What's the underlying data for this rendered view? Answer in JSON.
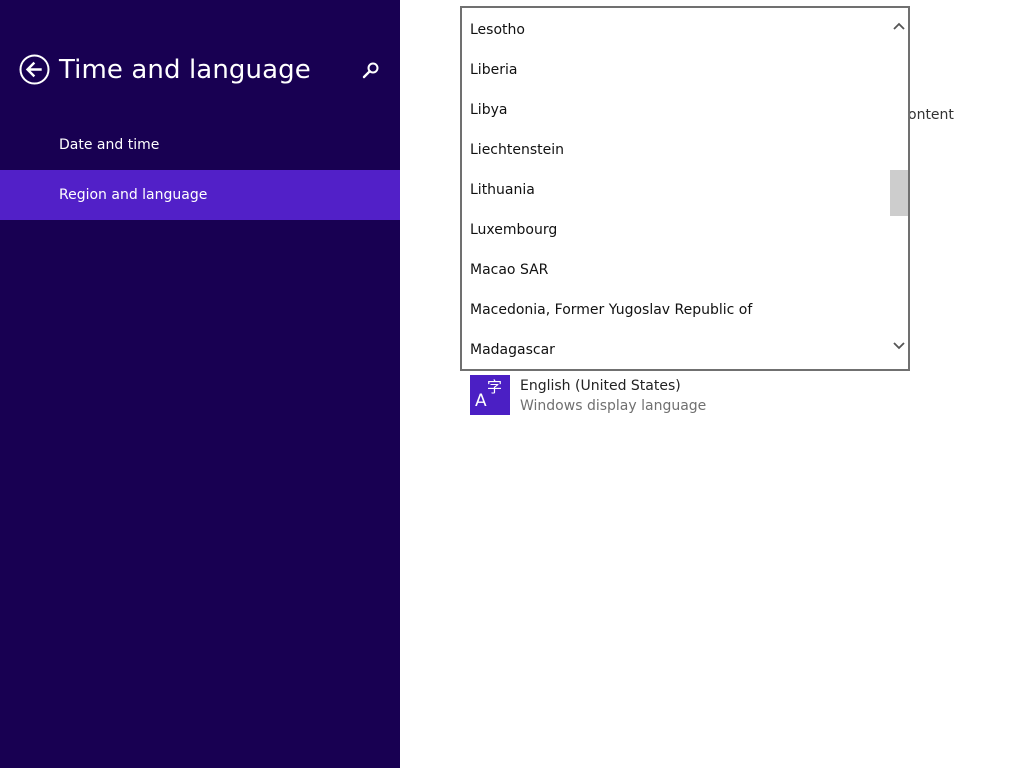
{
  "nav": {
    "title": "Time and language",
    "items": [
      {
        "label": "Date and time",
        "selected": false
      },
      {
        "label": "Region and language",
        "selected": true
      }
    ]
  },
  "content": {
    "partial_text": "ontent",
    "language": {
      "tile_glyph_a": "A",
      "tile_glyph_ji": "字",
      "name": "English (United States)",
      "subtitle": "Windows display language"
    }
  },
  "dropdown": {
    "items": [
      "Lesotho",
      "Liberia",
      "Libya",
      "Liechtenstein",
      "Lithuania",
      "Luxembourg",
      "Macao SAR",
      "Macedonia, Former Yugoslav Republic of",
      "Madagascar"
    ]
  },
  "colors": {
    "nav_background": "#180052",
    "nav_selected": "#5220c8",
    "language_tile": "#4b1fc4"
  },
  "icons": {
    "back": "back-arrow-circle-icon",
    "search": "search-icon",
    "scroll_up": "chevron-up-icon",
    "scroll_down": "chevron-down-icon"
  }
}
